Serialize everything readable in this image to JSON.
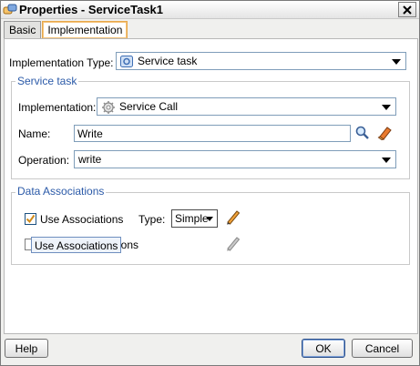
{
  "window": {
    "title": "Properties - ServiceTask1"
  },
  "tabs": [
    {
      "label": "Basic",
      "active": false
    },
    {
      "label": "Implementation",
      "active": true
    }
  ],
  "implementation_type": {
    "label": "Implementation Type:",
    "value": "Service task"
  },
  "service_task": {
    "title": "Service task",
    "implementation": {
      "label": "Implementation:",
      "value": "Service Call"
    },
    "name": {
      "label": "Name:",
      "value": "Write"
    },
    "operation": {
      "label": "Operation:",
      "value": "write"
    }
  },
  "data_associations": {
    "title": "Data Associations",
    "use_associations": {
      "label": "Use Associations",
      "checked": true
    },
    "type": {
      "label": "Type:",
      "value": "Simple"
    },
    "second_row": {
      "label_tail": "ions",
      "checked": false
    },
    "tooltip": "Use Associations"
  },
  "buttons": {
    "help": "Help",
    "ok": "OK",
    "cancel": "Cancel"
  },
  "colors": {
    "accent": "#2b5aa8",
    "tab_highlight": "#e8a84a",
    "field_border": "#7f9db9"
  },
  "icons": [
    "process-icon",
    "close-icon",
    "service-task-icon",
    "gear-icon",
    "search-icon",
    "eraser-icon",
    "pencil-icon",
    "chevron-down-icon",
    "checkmark-icon"
  ]
}
